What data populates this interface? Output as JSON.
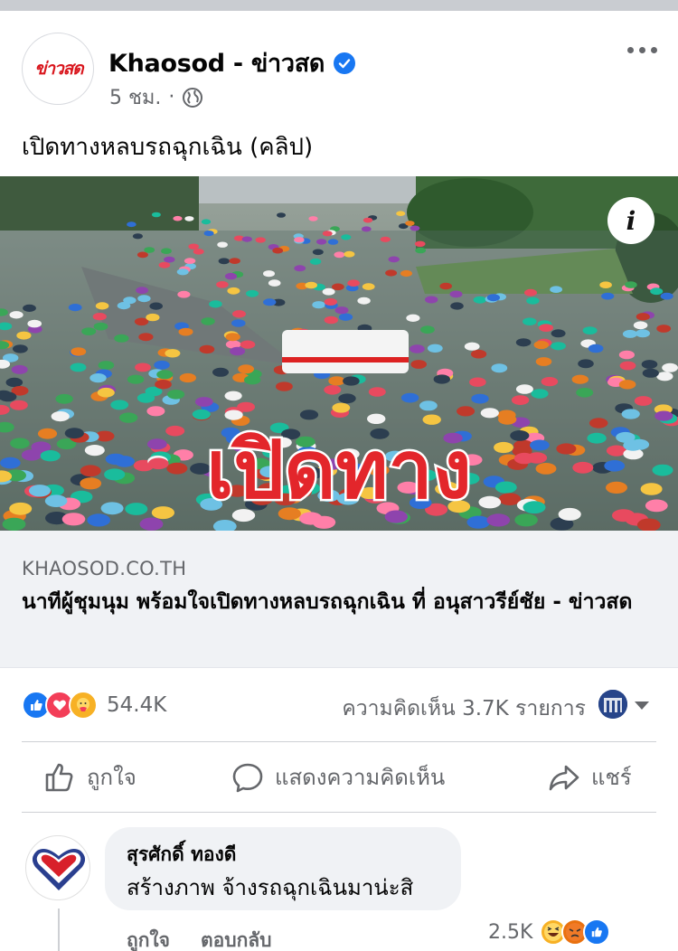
{
  "post": {
    "page_name": "Khaosod - ข่าวสด",
    "avatar_logo": "ข่าวสด",
    "timestamp": "5 ชม.",
    "separator": "·",
    "text": "เปิดทางหลบรถฉุกเฉิน (คลิป)",
    "image_overlay_text": "เปิดทาง"
  },
  "link_preview": {
    "domain": "KHAOSOD.CO.TH",
    "title": "นาทีผู้ชุมนุม พร้อมใจเปิดทางหลบรถฉุกเฉิน ที่ อนุสาวรีย์ชัย - ข่าวสด"
  },
  "stats": {
    "reaction_count": "54.4K",
    "comment_count": "ความคิดเห็น 3.7K รายการ"
  },
  "actions": {
    "like": "ถูกใจ",
    "comment": "แสดงความคิดเห็น",
    "share": "แชร์"
  },
  "comment": {
    "author": "สุรศักดิ์ ทองดี",
    "text": "สร้างภาพ จ้างรถฉุกเฉินมาน่ะสิ",
    "like_label": "ถูกใจ",
    "reply_label": "ตอบกลับ",
    "reaction_count": "2.5K"
  },
  "colors": {
    "brand_blue": "#1877f2",
    "love_red": "#f33e58",
    "care_yellow": "#f7b125",
    "secondary_text": "#65676b",
    "overlay_red": "#e3262b"
  }
}
